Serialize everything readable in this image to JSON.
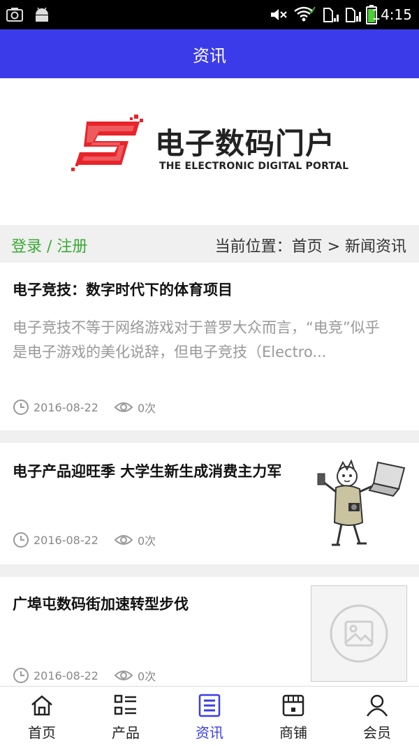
{
  "status_bar": {
    "time": "14:15"
  },
  "header": {
    "title": "资讯"
  },
  "banner": {
    "logo_cn": "电子数码门户",
    "logo_en": "THE ELECTRONIC DIGITAL PORTAL",
    "brand_color": "#e8242a"
  },
  "crumb": {
    "login": "登录 / 注册",
    "path": "当前位置：首页 > 新闻资讯"
  },
  "articles": [
    {
      "title": "电子竞技：数字时代下的体育项目",
      "excerpt": "电子竞技不等于网络游戏对于普罗大众而言，“电竞”似乎是电子游戏的美化说辞，但电子竞技（Electro...",
      "date": "2016-08-22",
      "views": "0次"
    },
    {
      "title": "电子产品迎旺季 大学生新生成消费主力军",
      "date": "2016-08-22",
      "views": "0次"
    },
    {
      "title": "广埠屯数码街加速转型步伐",
      "date": "2016-08-22",
      "views": "0次"
    }
  ],
  "tabs": [
    {
      "label": "首页",
      "icon": "home-icon"
    },
    {
      "label": "产品",
      "icon": "list-icon"
    },
    {
      "label": "资讯",
      "icon": "news-icon",
      "active": true
    },
    {
      "label": "商铺",
      "icon": "store-icon"
    },
    {
      "label": "会员",
      "icon": "user-icon"
    }
  ],
  "colors": {
    "accent": "#3b3bea",
    "login_green": "#3aaa35"
  }
}
